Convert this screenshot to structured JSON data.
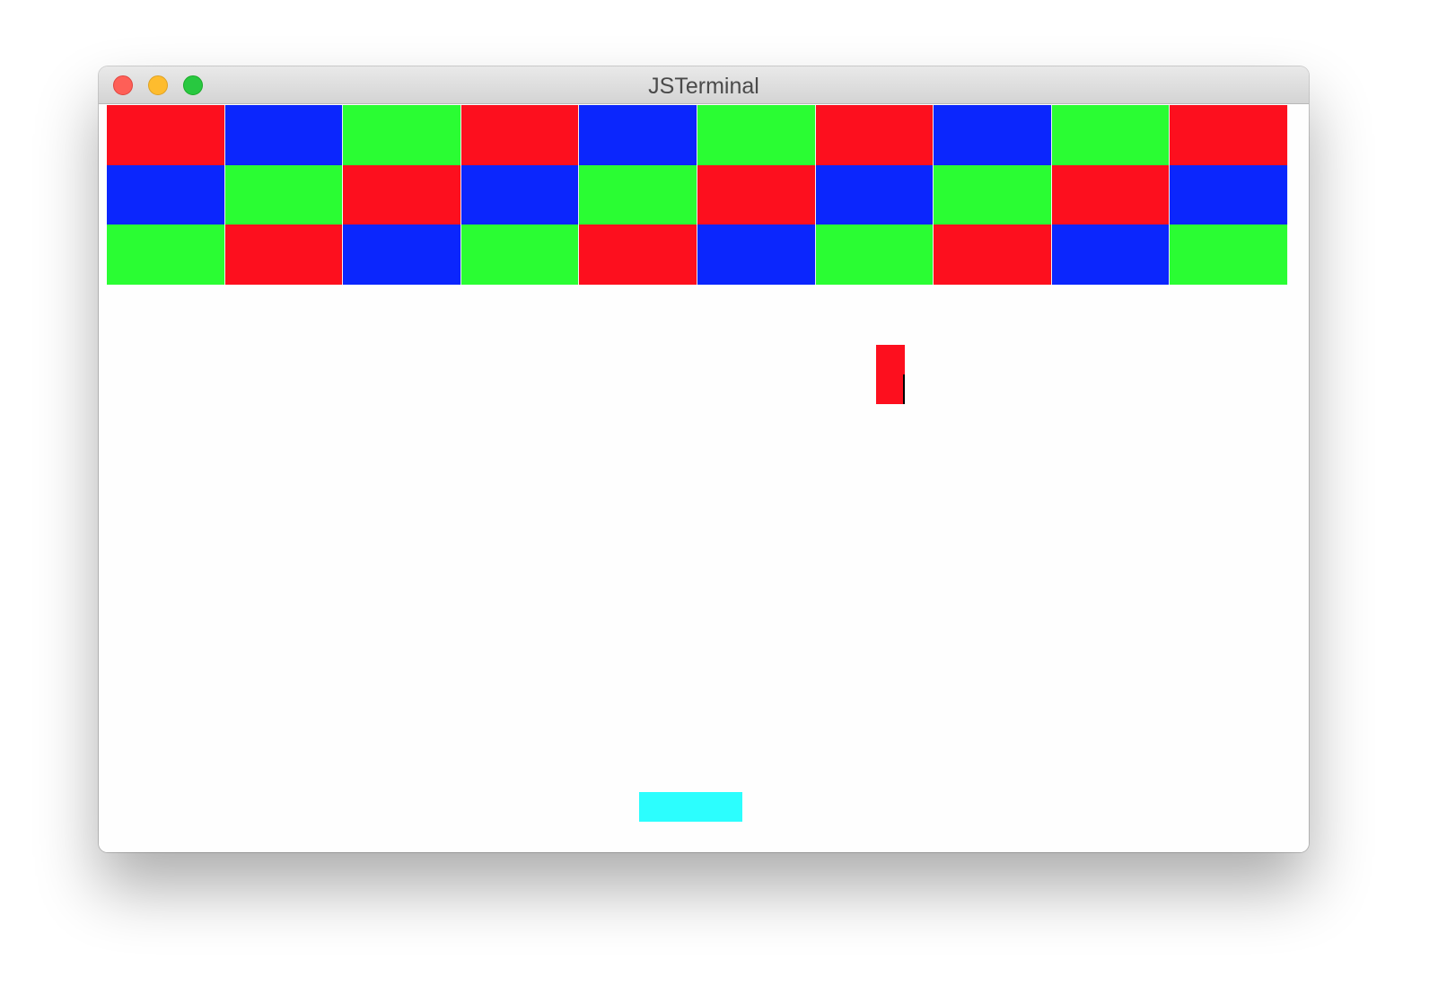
{
  "window": {
    "title": "JSTerminal"
  },
  "colors": {
    "red": "#fd0f1e",
    "blue": "#0b26fd",
    "green": "#2afd33",
    "cyan": "#2cfefe"
  },
  "bricks": [
    [
      "red",
      "blue",
      "green",
      "red",
      "blue",
      "green",
      "red",
      "blue",
      "green",
      "red"
    ],
    [
      "blue",
      "green",
      "red",
      "blue",
      "green",
      "red",
      "blue",
      "green",
      "red",
      "blue"
    ],
    [
      "green",
      "red",
      "blue",
      "green",
      "red",
      "blue",
      "green",
      "red",
      "blue",
      "green"
    ]
  ],
  "ball": {
    "color": "red"
  },
  "paddle": {
    "color": "cyan"
  }
}
